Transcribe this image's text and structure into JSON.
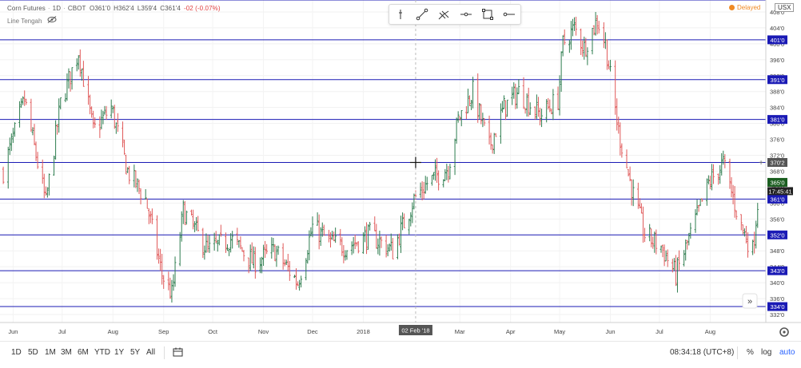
{
  "header": {
    "symbol": "Corn Futures",
    "interval": "1D",
    "exchange": "CBOT",
    "ohlc": [
      "O361'0",
      "H362'4",
      "L359'4",
      "C361'4"
    ],
    "change": "-02 (-0.07%)",
    "indicator": "Line Tengah",
    "delayed_label": "Delayed",
    "currency": "USX",
    "eye_icon": "eye-off-icon"
  },
  "drawing_tools": [
    "cursor-cross-icon",
    "trend-line-icon",
    "pitchfork-icon",
    "horizontal-ray-icon",
    "rectangle-icon",
    "horizontal-line-icon"
  ],
  "timeframes": [
    "1D",
    "5D",
    "1M",
    "3M",
    "6M",
    "YTD",
    "1Y",
    "5Y",
    "All"
  ],
  "bottom_bar": {
    "clock": "08:34:18 (UTC+8)",
    "percent": "%",
    "log": "log",
    "auto": "auto"
  },
  "colors": {
    "up": "#2e7d4f",
    "down": "#e05a5a",
    "level_line": "#1a1ab5",
    "price_tag_bg": "#1a1ab5",
    "last_price_bg": "#1b5e20",
    "countdown_bg": "#222222",
    "crosshair_tag_bg": "#555555"
  },
  "chart_data": {
    "type": "candlestick",
    "symbol": "Corn Futures",
    "y_axis": {
      "ticks": [
        "408'0",
        "404'0",
        "400'0",
        "396'0",
        "392'0",
        "388'0",
        "384'0",
        "380'0",
        "376'0",
        "372'0",
        "368'0",
        "364'0",
        "360'0",
        "356'0",
        "352'0",
        "348'0",
        "344'0",
        "340'0",
        "336'0",
        "332'0"
      ],
      "tick_values": [
        408,
        404,
        400,
        396,
        392,
        388,
        384,
        380,
        376,
        372,
        368,
        364,
        360,
        356,
        352,
        348,
        344,
        340,
        336,
        332
      ],
      "range": [
        330,
        411
      ]
    },
    "x_axis": {
      "ticks": [
        "Jun",
        "Jul",
        "Aug",
        "Sep",
        "Oct",
        "Nov",
        "Dec",
        "2018",
        "Mar",
        "Apr",
        "May",
        "Jun",
        "Jul",
        "Aug"
      ],
      "tick_dates": [
        "2017-06-01",
        "2017-07-01",
        "2017-08-01",
        "2017-09-01",
        "2017-10-01",
        "2017-11-01",
        "2017-12-01",
        "2018-01-01",
        "2018-03-01",
        "2018-04-01",
        "2018-05-01",
        "2018-06-01",
        "2018-07-01",
        "2018-08-01"
      ],
      "crosshair_label": "02 Feb '18"
    },
    "horizontal_levels": [
      {
        "value": 411,
        "label": ""
      },
      {
        "value": 401,
        "label": "401'0"
      },
      {
        "value": 391,
        "label": "391'0"
      },
      {
        "value": 381,
        "label": "381'0"
      },
      {
        "value": 370.2,
        "label": "370'2"
      },
      {
        "value": 361,
        "label": "361'0"
      },
      {
        "value": 352,
        "label": "352'0"
      },
      {
        "value": 343,
        "label": "343'0"
      },
      {
        "value": 334,
        "label": "334'0"
      }
    ],
    "last_price": {
      "value": 365,
      "label": "365'0"
    },
    "countdown": "17:45:41",
    "candles_path": [
      [
        "2017-05-26",
        368
      ],
      [
        "2017-06-08",
        386
      ],
      [
        "2017-06-21",
        360
      ],
      [
        "2017-06-30",
        385
      ],
      [
        "2017-07-11",
        398
      ],
      [
        "2017-07-20",
        378
      ],
      [
        "2017-07-31",
        384
      ],
      [
        "2017-08-10",
        368
      ],
      [
        "2017-08-21",
        361
      ],
      [
        "2017-08-31",
        342
      ],
      [
        "2017-09-06",
        337
      ],
      [
        "2017-09-13",
        358
      ],
      [
        "2017-09-28",
        348
      ],
      [
        "2017-10-12",
        351
      ],
      [
        "2017-10-26",
        345
      ],
      [
        "2017-11-08",
        348
      ],
      [
        "2017-11-22",
        340
      ],
      [
        "2017-12-01",
        354
      ],
      [
        "2017-12-12",
        350
      ],
      [
        "2017-12-22",
        349
      ],
      [
        "2018-01-05",
        352
      ],
      [
        "2018-01-19",
        348
      ],
      [
        "2018-02-01",
        361
      ],
      [
        "2018-02-09",
        365
      ],
      [
        "2018-02-22",
        369
      ],
      [
        "2018-02-28",
        381
      ],
      [
        "2018-03-09",
        388
      ],
      [
        "2018-03-19",
        374
      ],
      [
        "2018-03-28",
        384
      ],
      [
        "2018-04-06",
        388
      ],
      [
        "2018-04-19",
        382
      ],
      [
        "2018-04-30",
        386
      ],
      [
        "2018-05-03",
        400
      ],
      [
        "2018-05-10",
        404
      ],
      [
        "2018-05-16",
        399
      ],
      [
        "2018-05-24",
        406
      ],
      [
        "2018-05-29",
        400
      ],
      [
        "2018-06-06",
        378
      ],
      [
        "2018-06-15",
        362
      ],
      [
        "2018-06-22",
        352
      ],
      [
        "2018-07-02",
        349
      ],
      [
        "2018-07-11",
        342
      ],
      [
        "2018-07-20",
        352
      ],
      [
        "2018-07-31",
        365
      ],
      [
        "2018-08-09",
        370
      ],
      [
        "2018-08-20",
        354
      ],
      [
        "2018-08-27",
        348
      ],
      [
        "2018-08-31",
        364
      ]
    ]
  }
}
